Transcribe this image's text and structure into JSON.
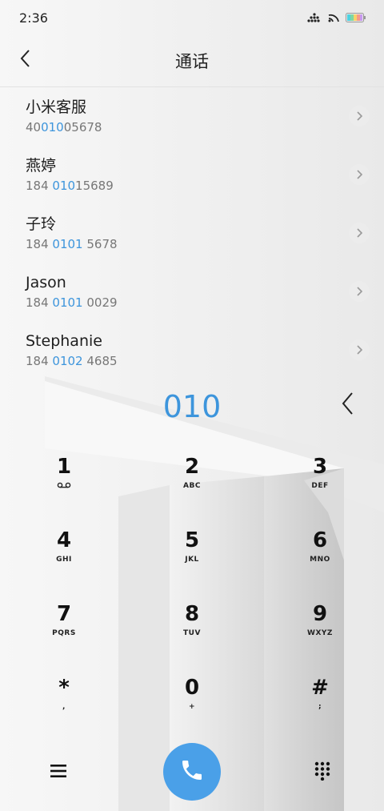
{
  "status_bar": {
    "time": "2:36",
    "icons": [
      "signal-dots-icon",
      "wifi-icon",
      "battery-icon"
    ]
  },
  "header": {
    "title": "通话",
    "back_icon": "chevron-left-icon"
  },
  "contacts": [
    {
      "name": "小米客服",
      "number_pre": "40",
      "number_hl": "010",
      "number_post": "05678"
    },
    {
      "name": "燕婷",
      "number_pre": "184 ",
      "number_hl": "010",
      "number_post": "15689"
    },
    {
      "name": "子玲",
      "number_pre": "184 ",
      "number_hl": "0101",
      "number_post": " 5678"
    },
    {
      "name": "Jason",
      "number_pre": "184 ",
      "number_hl": "0101",
      "number_post": " 0029"
    },
    {
      "name": "Stephanie",
      "number_pre": "184 ",
      "number_hl": "0102",
      "number_post": " 4685"
    }
  ],
  "dialer": {
    "display": "010",
    "accent_color": "#3d95dc",
    "keys": [
      [
        {
          "digit": "1",
          "letters": "voicemail"
        },
        {
          "digit": "2",
          "letters": "ABC"
        },
        {
          "digit": "3",
          "letters": "DEF"
        }
      ],
      [
        {
          "digit": "4",
          "letters": "GHI"
        },
        {
          "digit": "5",
          "letters": "JKL"
        },
        {
          "digit": "6",
          "letters": "MNO"
        }
      ],
      [
        {
          "digit": "7",
          "letters": "PQRS"
        },
        {
          "digit": "8",
          "letters": "TUV"
        },
        {
          "digit": "9",
          "letters": "WXYZ"
        }
      ],
      [
        {
          "digit": "*",
          "letters": ","
        },
        {
          "digit": "0",
          "letters": "+"
        },
        {
          "digit": "#",
          "letters": ";"
        }
      ]
    ]
  },
  "bottom_bar": {
    "menu_icon": "menu-icon",
    "call_icon": "phone-icon",
    "call_color": "#4aa0e8",
    "keypad_icon": "dialpad-grid-icon"
  }
}
